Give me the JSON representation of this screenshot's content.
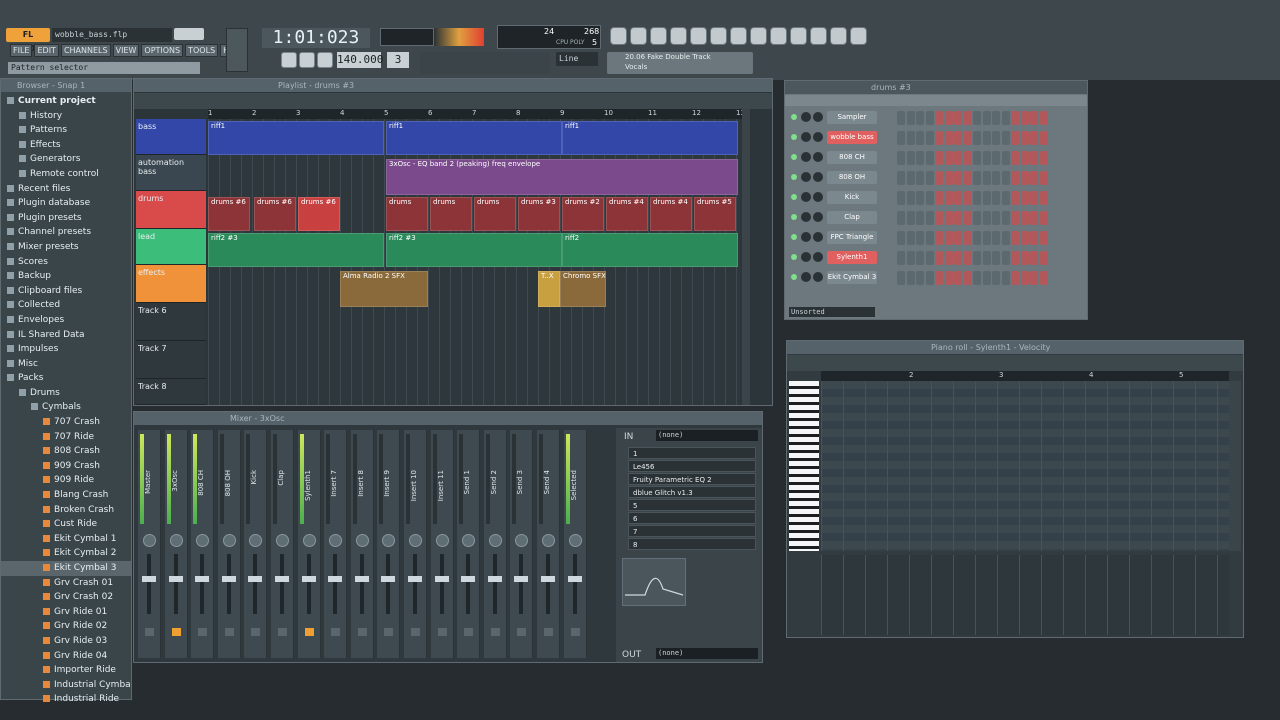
{
  "app": {
    "logo": "FL STUDIO",
    "project_file": "wobble_bass.flp",
    "menu": [
      "FILE",
      "EDIT",
      "CHANNELS",
      "VIEW",
      "OPTIONS",
      "TOOLS",
      "HELP"
    ],
    "hint_bar": "Pattern selector",
    "time_display": "1:01:023",
    "tempo": "140.000",
    "pattern_num": "3",
    "snap": "Line",
    "cpu_value": "24",
    "ram_value": "268",
    "poly_value": "5",
    "cpu_label": "CPU",
    "poly_label": "POLY",
    "preset_line1": "20.06 Fake Double Track",
    "preset_line2": "Vocals"
  },
  "browser": {
    "title": "Browser - Snap 1",
    "items": [
      {
        "label": "Current project",
        "level": 0,
        "bold": true
      },
      {
        "label": "History",
        "level": 1
      },
      {
        "label": "Patterns",
        "level": 1
      },
      {
        "label": "Effects",
        "level": 1
      },
      {
        "label": "Generators",
        "level": 1
      },
      {
        "label": "Remote control",
        "level": 1
      },
      {
        "label": "Recent files",
        "level": 0
      },
      {
        "label": "Plugin database",
        "level": 0
      },
      {
        "label": "Plugin presets",
        "level": 0
      },
      {
        "label": "Channel presets",
        "level": 0
      },
      {
        "label": "Mixer presets",
        "level": 0
      },
      {
        "label": "Scores",
        "level": 0
      },
      {
        "label": "Backup",
        "level": 0
      },
      {
        "label": "Clipboard files",
        "level": 0
      },
      {
        "label": "Collected",
        "level": 0
      },
      {
        "label": "Envelopes",
        "level": 0
      },
      {
        "label": "IL Shared Data",
        "level": 0
      },
      {
        "label": "Impulses",
        "level": 0
      },
      {
        "label": "Misc",
        "level": 0
      },
      {
        "label": "Packs",
        "level": 0
      },
      {
        "label": "Drums",
        "level": 1
      },
      {
        "label": "Cymbals",
        "level": 2
      },
      {
        "label": "707 Crash",
        "level": 3
      },
      {
        "label": "707 Ride",
        "level": 3
      },
      {
        "label": "808 Crash",
        "level": 3
      },
      {
        "label": "909 Crash",
        "level": 3
      },
      {
        "label": "909 Ride",
        "level": 3
      },
      {
        "label": "Blang Crash",
        "level": 3
      },
      {
        "label": "Broken Crash",
        "level": 3
      },
      {
        "label": "Cust Ride",
        "level": 3
      },
      {
        "label": "Ekit Cymbal 1",
        "level": 3
      },
      {
        "label": "Ekit Cymbal 2",
        "level": 3
      },
      {
        "label": "Ekit Cymbal 3",
        "level": 3,
        "selected": true
      },
      {
        "label": "Grv Crash 01",
        "level": 3
      },
      {
        "label": "Grv Crash 02",
        "level": 3
      },
      {
        "label": "Grv Ride 01",
        "level": 3
      },
      {
        "label": "Grv Ride 02",
        "level": 3
      },
      {
        "label": "Grv Ride 03",
        "level": 3
      },
      {
        "label": "Grv Ride 04",
        "level": 3
      },
      {
        "label": "Importer Ride",
        "level": 3
      },
      {
        "label": "Industrial Cymbal",
        "level": 3
      },
      {
        "label": "Industrial Ride",
        "level": 3
      }
    ]
  },
  "playlist": {
    "title": "Playlist - drums #3",
    "ruler": [
      "1",
      "2",
      "3",
      "4",
      "5",
      "6",
      "7",
      "8",
      "9",
      "10",
      "11",
      "12",
      "13"
    ],
    "tracks": [
      {
        "name": "bass",
        "color": "#3247a8"
      },
      {
        "name": "automation bass",
        "color": "#3a4650"
      },
      {
        "name": "drums",
        "color": "#d94a4a"
      },
      {
        "name": "lead",
        "color": "#3dbd7a"
      },
      {
        "name": "effects",
        "color": "#f0923a"
      },
      {
        "name": "Track 6",
        "color": ""
      },
      {
        "name": "Track 7",
        "color": ""
      },
      {
        "name": "Track 8",
        "color": ""
      }
    ],
    "clips": {
      "bass": [
        "riff1",
        "riff1",
        "riff1"
      ],
      "automation": "3xOsc - EQ band 2 (peaking) freq envelope",
      "drums": [
        "drums #6",
        "drums #6",
        "drums #6",
        "drums",
        "drums",
        "drums",
        "drums #3",
        "drums #2",
        "drums #4",
        "drums #4",
        "drums #5"
      ],
      "lead": [
        "riff2 #3",
        "riff2 #3",
        "riff2"
      ],
      "effects": [
        "Alma Radio 2 SFX",
        "T..X",
        "Chromo SFX"
      ]
    }
  },
  "step_seq": {
    "title": "drums #3",
    "filter": "Unsorted",
    "channels": [
      {
        "name": "Sampler",
        "highlight": false
      },
      {
        "name": "wobble bass",
        "highlight": true
      },
      {
        "name": "808 CH",
        "highlight": false
      },
      {
        "name": "808 OH",
        "highlight": false
      },
      {
        "name": "Kick",
        "highlight": false
      },
      {
        "name": "Clap",
        "highlight": false
      },
      {
        "name": "FPC Triangle",
        "highlight": false
      },
      {
        "name": "Sylenth1",
        "highlight": true
      },
      {
        "name": "Ekit Cymbal 3",
        "highlight": false
      }
    ]
  },
  "mixer": {
    "title": "Mixer - 3xOsc",
    "strips": [
      "Master",
      "3xOsc",
      "808 CH",
      "808 OH",
      "Kick",
      "Clap",
      "Sylenth1",
      "Insert 7",
      "Insert 8",
      "Insert 9",
      "Insert 10",
      "Insert 11",
      "Send 1",
      "Send 2",
      "Send 3",
      "Send 4",
      "Selected"
    ],
    "in_label": "IN",
    "in_value": "(none)",
    "out_label": "OUT",
    "out_value": "(none)",
    "fx_slots": [
      "1",
      "Le456",
      "Fruity Parametric EQ 2",
      "dblue Glitch v1.3",
      "5",
      "6",
      "7",
      "8"
    ]
  },
  "piano_roll": {
    "title": "Piano roll - Sylenth1 - Velocity",
    "ruler": [
      "2",
      "3",
      "4",
      "5"
    ]
  }
}
